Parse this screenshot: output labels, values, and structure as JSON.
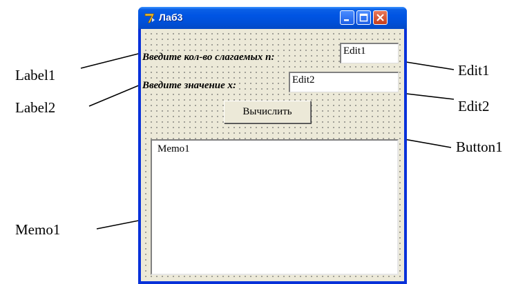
{
  "window": {
    "title": "Лаб3",
    "app_icon": "delphi-7-icon"
  },
  "form": {
    "label1": "Введите кол-во слагаемых n:",
    "edit1": "Edit1",
    "label2": "Введите значение x:",
    "edit2": "Edit2",
    "button1": "Вычислить",
    "memo1": "Memo1"
  },
  "callouts": {
    "label1": "Label1",
    "label2": "Label2",
    "memo1": "Memo1",
    "edit1": "Edit1",
    "edit2": "Edit2",
    "button1": "Button1"
  },
  "colors": {
    "titlebar": "#0054e3",
    "frame": "#0831d9",
    "client": "#ece9d8",
    "close_button": "#c53d1b"
  }
}
